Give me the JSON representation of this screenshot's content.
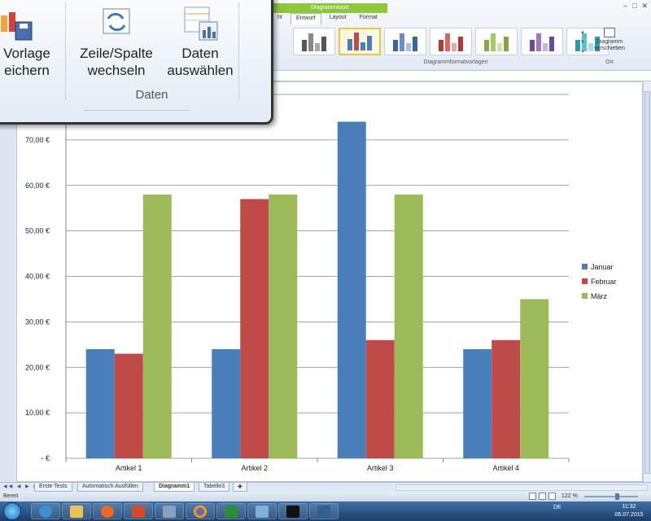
{
  "ribbon": {
    "context_header": "Diagrammtools",
    "tabs": [
      "Entwurf",
      "Layout",
      "Format"
    ],
    "partial_tab": "ht",
    "active_tab": "Entwurf",
    "window_controls": [
      "–",
      "□",
      "✕"
    ],
    "gallery_label": "Diagrammformatvorlagen",
    "move_chart_label": "Diagramm verschieben",
    "location_group": "Ort"
  },
  "zoom_overlay": {
    "save_template_label_line1": "Vorlage",
    "save_template_label_line2": "eichern",
    "switch_label_line1": "Zeile/Spalte",
    "switch_label_line2": "wechseln",
    "select_data_label_line1": "Daten",
    "select_data_label_line2": "auswählen",
    "group_label": "Daten"
  },
  "chart_data": {
    "type": "bar",
    "categories": [
      "Artikel 1",
      "Artikel 2",
      "Artikel 3",
      "Artikel 4"
    ],
    "series": [
      {
        "name": "Januar",
        "values": [
          24,
          24,
          74,
          24
        ],
        "color": "#4a7ebb"
      },
      {
        "name": "Februar",
        "values": [
          23,
          57,
          26,
          26
        ],
        "color": "#be4b48"
      },
      {
        "name": "März",
        "values": [
          58,
          58,
          58,
          35
        ],
        "color": "#9bbb59"
      }
    ],
    "ylim": [
      0,
      80
    ],
    "yticks": [
      0,
      10,
      20,
      30,
      40,
      50,
      60,
      70,
      80
    ],
    "ytick_labels": [
      "- €",
      "10,00 €",
      "20,00 €",
      "30,00 €",
      "40,00 €",
      "50,00 €",
      "60,00 €",
      "70,00 €",
      ""
    ],
    "legend_position": "right",
    "grid": true
  },
  "sheet_tabs": [
    "Erste Tests",
    "Automatisch Ausfüllen",
    "Diagramm1",
    "Tabelle3"
  ],
  "active_sheet": "Diagramm1",
  "status": {
    "ready_text": "Bereit",
    "zoom": "122 %"
  },
  "taskbar": {
    "language": "DE",
    "time": "11:32",
    "date": "06.07.2015"
  }
}
